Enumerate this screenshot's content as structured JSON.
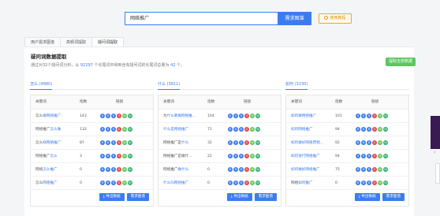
{
  "search": {
    "value": "网络推广",
    "button": "需求图谱",
    "tutorial": "使用教程"
  },
  "tabs": [
    "用户需求图谱",
    "高频词提取",
    "疑问词提取"
  ],
  "panel": {
    "title": "疑问词数据提取",
    "desc_prefix": "通过对32个疑问词分析，从",
    "desc_num1": "92297",
    "desc_mid": "个长尾词中得到含有疑问词的长尾词总量为",
    "desc_num2": "42",
    "desc_suffix": "个。",
    "extract_all": "提取全部数据"
  },
  "table_headers": {
    "keyword": "关键词",
    "index": "指数",
    "links": "链接"
  },
  "columns": [
    {
      "header": "怎么 (4880)",
      "rows": [
        {
          "k1": "怎么",
          "k2": "做网络推广",
          "v": "143"
        },
        {
          "k1": "网络推广",
          "k2": "怎么做",
          "v": "132"
        },
        {
          "k1": "怎么",
          "k2": "样网络推广",
          "v": "87"
        },
        {
          "k1": "网络推广",
          "k2": "怎么",
          "v": "3"
        },
        {
          "k1": "网络",
          "k2": "怎么推广",
          "v": "0"
        },
        {
          "k1": "怎么",
          "k2": "网络推广",
          "v": "0"
        }
      ],
      "export": "导出数据",
      "graph": "需求图谱"
    },
    {
      "header": "什么 (3811)",
      "rows": [
        {
          "k1": "为",
          "k2": "什么要做网络推...",
          "v": "104"
        },
        {
          "k1": "",
          "k2": "什么是网络推广",
          "v": "71"
        },
        {
          "k1": "网络推广是",
          "k2": "什么",
          "v": "32"
        },
        {
          "k1": "网络推广是做什...",
          "k2": "",
          "v": "22"
        },
        {
          "k1": "网络推广",
          "k2": "做什么",
          "v": "0"
        },
        {
          "k1": "",
          "k2": "什么叫网络推广",
          "v": "0"
        }
      ],
      "export": "导出数据",
      "graph": "需求图谱"
    },
    {
      "header": "如何 (3230)",
      "rows": [
        {
          "k1": "",
          "k2": "如何做网络推广",
          "v": "101"
        },
        {
          "k1": "",
          "k2": "如何网络推广",
          "v": "94"
        },
        {
          "k1": "",
          "k2": "如何做好网络营销...",
          "v": "92"
        },
        {
          "k1": "",
          "k2": "如何进行网络推广",
          "v": "94"
        },
        {
          "k1": "",
          "k2": "如何做好网络推广",
          "v": "75"
        },
        {
          "k1": "网络",
          "k2": "如何推广",
          "v": "0"
        }
      ],
      "export": "导出数据",
      "graph": "需求图谱"
    }
  ],
  "colors": {
    "accent": "#3d7cf0",
    "green": "#5ec55e",
    "orange": "#e39511"
  },
  "link_icons": [
    "blue-circle-icon",
    "blue-circle-icon",
    "blue-circle-icon",
    "red-circle-icon",
    "green-circle-icon",
    "green-circle-icon"
  ]
}
